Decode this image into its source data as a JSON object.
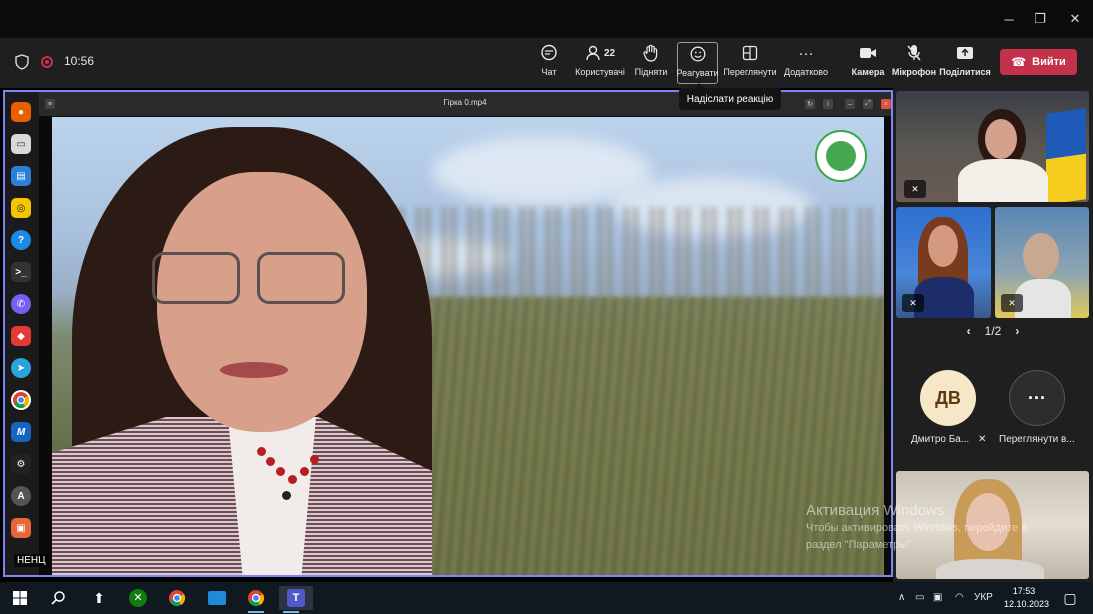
{
  "window": {
    "minimize_icon": "minimize-icon",
    "restore_icon": "restore-icon",
    "close_icon": "close-icon"
  },
  "meeting": {
    "timer": "10:56",
    "toolbar": {
      "chat": "Чат",
      "people": "Користувачі",
      "people_count": "22",
      "raise": "Підняти",
      "react": "Реагувати",
      "view": "Переглянути",
      "more": "Додатково",
      "camera": "Камера",
      "mic": "Мікрофон",
      "share": "Поділитися",
      "leave": "Вийти"
    },
    "tooltip": "Надіслати реакцію"
  },
  "stage": {
    "player_title": "Гірка 0.mp4",
    "lang_badge": "НЕНЦ"
  },
  "panel": {
    "pager": "1/2",
    "participants": [
      {
        "initials": "ДВ",
        "name": "Дмитро Ба..."
      },
      {
        "initials": "···",
        "name": "Переглянути в..."
      }
    ]
  },
  "watermark": {
    "title": "Активация Windows",
    "line1": "Чтобы активировать Windows, перейдите в",
    "line2": "раздел \"Параметры\"."
  },
  "taskbar": {
    "lang": "УКР",
    "time": "17:53",
    "date": "12.10.2023"
  },
  "colors": {
    "accent": "#7f85f5",
    "leave": "#c4314b",
    "bar": "#1f1f1f"
  }
}
